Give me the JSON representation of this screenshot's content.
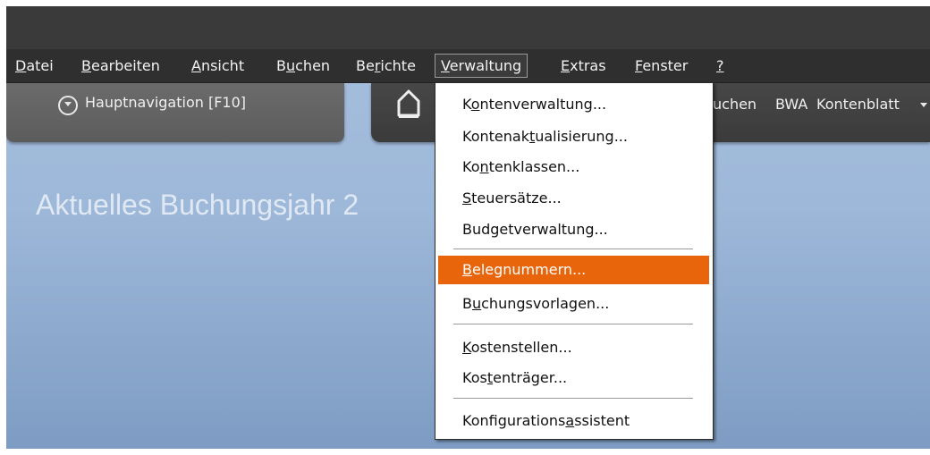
{
  "menubar": {
    "items": [
      {
        "pre": "",
        "u": "D",
        "post": "atei"
      },
      {
        "pre": "",
        "u": "B",
        "post": "earbeiten"
      },
      {
        "pre": "",
        "u": "A",
        "post": "nsicht"
      },
      {
        "pre": "B",
        "u": "u",
        "post": "chen"
      },
      {
        "pre": "Be",
        "u": "r",
        "post": "ichte"
      },
      {
        "pre": "",
        "u": "V",
        "post": "erwaltung"
      },
      {
        "pre": "",
        "u": "E",
        "post": "xtras"
      },
      {
        "pre": "",
        "u": "F",
        "post": "enster"
      },
      {
        "pre": "",
        "u": "?",
        "post": ""
      }
    ]
  },
  "navbar": {
    "hauptnavigation": "Hauptnavigation [F10]",
    "items": [
      "uchen",
      "BWA",
      "Kontenblatt"
    ]
  },
  "main": {
    "headline": "Aktuelles Buchungsjahr 2"
  },
  "dropdown": {
    "items": [
      {
        "pre": "K",
        "u": "o",
        "post": "ntenverwaltung..."
      },
      {
        "pre": "Kontenak",
        "u": "t",
        "post": "ualisierung..."
      },
      {
        "pre": "Ko",
        "u": "n",
        "post": "tenklassen..."
      },
      {
        "pre": "",
        "u": "S",
        "post": "teuersätze..."
      },
      {
        "pre": "Budgetverwaltung...",
        "u": "",
        "post": ""
      },
      {
        "pre": "",
        "u": "B",
        "post": "elegnummern..."
      },
      {
        "pre": "B",
        "u": "u",
        "post": "chungsvorlagen..."
      },
      {
        "pre": "",
        "u": "K",
        "post": "ostenstellen..."
      },
      {
        "pre": "Kos",
        "u": "t",
        "post": "enträger..."
      },
      {
        "pre": "Konfigurations",
        "u": "a",
        "post": "ssistent"
      }
    ]
  }
}
